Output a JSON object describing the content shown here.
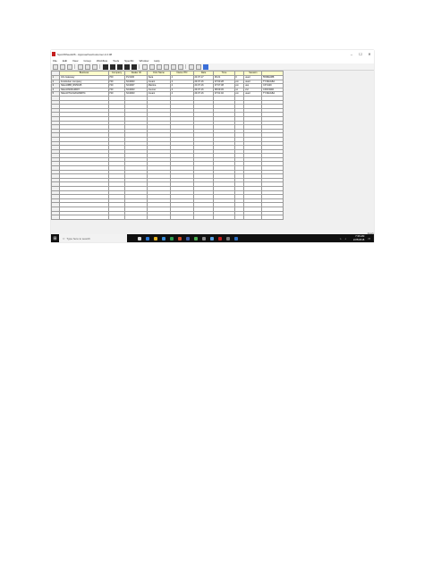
{
  "window": {
    "title": "SportWheels06 - ApproachesCustomer.2.2.08",
    "minimize": "–",
    "maximize": "☐",
    "close": "✕"
  },
  "menu": [
    "File",
    "Edit",
    "View",
    "Group",
    "Workflow",
    "Tools",
    "Specific",
    "Window",
    "Help"
  ],
  "grid": {
    "columns": [
      "",
      "Business",
      "Company",
      "Dealer ID",
      "First Name",
      "Name ITD",
      "Date",
      "Time",
      "",
      "Session",
      ""
    ],
    "rows": [
      [
        "1",
        "Info Gateway",
        "700",
        "FV3100",
        "Sara",
        "4",
        "23.07.17",
        "06:21",
        "0",
        "used",
        "55SBA388"
      ],
      [
        "2",
        "Footlocker company",
        "720",
        "NC2903",
        "Jovani",
        "4",
        "29.07.16",
        "07:03:28",
        "om",
        "used",
        "TY39AG8A"
      ],
      [
        "3",
        "NikonDBB_RN5D45",
        "720",
        "NC2907",
        "Martina",
        "4",
        "20.07.16",
        "07:07:38",
        "om",
        "usp",
        "CFYA39"
      ],
      [
        "4",
        "NikonDSWGR097",
        "720",
        "NC2903",
        "Joumer",
        "4",
        "29.07.16",
        "08:09:45",
        "vo",
        "vivl",
        "CFSTARR"
      ],
      [
        "5",
        "NikonDTG3120HN9874",
        "720",
        "NC2903",
        "Jovani",
        "4",
        "29.07.16",
        "07:01:02",
        "om",
        "used",
        "TY39AG8A"
      ]
    ],
    "empty_rows": 30
  },
  "status": "Ready",
  "taskbar": {
    "start_icon": "windows-logo-icon",
    "search_placeholder": "Type here to search",
    "time": "7:36 AM",
    "date": "2/25/2018"
  }
}
